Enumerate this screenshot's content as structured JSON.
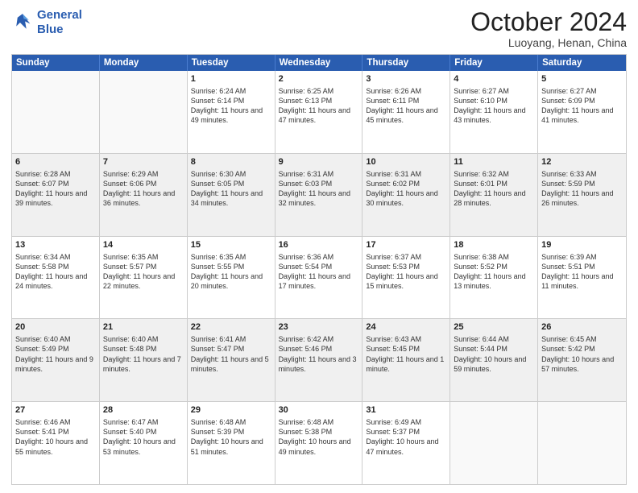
{
  "header": {
    "logo_line1": "General",
    "logo_line2": "Blue",
    "main_title": "October 2024",
    "subtitle": "Luoyang, Henan, China"
  },
  "days_of_week": [
    "Sunday",
    "Monday",
    "Tuesday",
    "Wednesday",
    "Thursday",
    "Friday",
    "Saturday"
  ],
  "weeks": [
    [
      {
        "day": "",
        "empty": true
      },
      {
        "day": "",
        "empty": true
      },
      {
        "day": "1",
        "sunrise": "Sunrise: 6:24 AM",
        "sunset": "Sunset: 6:14 PM",
        "daylight": "Daylight: 11 hours and 49 minutes."
      },
      {
        "day": "2",
        "sunrise": "Sunrise: 6:25 AM",
        "sunset": "Sunset: 6:13 PM",
        "daylight": "Daylight: 11 hours and 47 minutes."
      },
      {
        "day": "3",
        "sunrise": "Sunrise: 6:26 AM",
        "sunset": "Sunset: 6:11 PM",
        "daylight": "Daylight: 11 hours and 45 minutes."
      },
      {
        "day": "4",
        "sunrise": "Sunrise: 6:27 AM",
        "sunset": "Sunset: 6:10 PM",
        "daylight": "Daylight: 11 hours and 43 minutes."
      },
      {
        "day": "5",
        "sunrise": "Sunrise: 6:27 AM",
        "sunset": "Sunset: 6:09 PM",
        "daylight": "Daylight: 11 hours and 41 minutes."
      }
    ],
    [
      {
        "day": "6",
        "sunrise": "Sunrise: 6:28 AM",
        "sunset": "Sunset: 6:07 PM",
        "daylight": "Daylight: 11 hours and 39 minutes."
      },
      {
        "day": "7",
        "sunrise": "Sunrise: 6:29 AM",
        "sunset": "Sunset: 6:06 PM",
        "daylight": "Daylight: 11 hours and 36 minutes."
      },
      {
        "day": "8",
        "sunrise": "Sunrise: 6:30 AM",
        "sunset": "Sunset: 6:05 PM",
        "daylight": "Daylight: 11 hours and 34 minutes."
      },
      {
        "day": "9",
        "sunrise": "Sunrise: 6:31 AM",
        "sunset": "Sunset: 6:03 PM",
        "daylight": "Daylight: 11 hours and 32 minutes."
      },
      {
        "day": "10",
        "sunrise": "Sunrise: 6:31 AM",
        "sunset": "Sunset: 6:02 PM",
        "daylight": "Daylight: 11 hours and 30 minutes."
      },
      {
        "day": "11",
        "sunrise": "Sunrise: 6:32 AM",
        "sunset": "Sunset: 6:01 PM",
        "daylight": "Daylight: 11 hours and 28 minutes."
      },
      {
        "day": "12",
        "sunrise": "Sunrise: 6:33 AM",
        "sunset": "Sunset: 5:59 PM",
        "daylight": "Daylight: 11 hours and 26 minutes."
      }
    ],
    [
      {
        "day": "13",
        "sunrise": "Sunrise: 6:34 AM",
        "sunset": "Sunset: 5:58 PM",
        "daylight": "Daylight: 11 hours and 24 minutes."
      },
      {
        "day": "14",
        "sunrise": "Sunrise: 6:35 AM",
        "sunset": "Sunset: 5:57 PM",
        "daylight": "Daylight: 11 hours and 22 minutes."
      },
      {
        "day": "15",
        "sunrise": "Sunrise: 6:35 AM",
        "sunset": "Sunset: 5:55 PM",
        "daylight": "Daylight: 11 hours and 20 minutes."
      },
      {
        "day": "16",
        "sunrise": "Sunrise: 6:36 AM",
        "sunset": "Sunset: 5:54 PM",
        "daylight": "Daylight: 11 hours and 17 minutes."
      },
      {
        "day": "17",
        "sunrise": "Sunrise: 6:37 AM",
        "sunset": "Sunset: 5:53 PM",
        "daylight": "Daylight: 11 hours and 15 minutes."
      },
      {
        "day": "18",
        "sunrise": "Sunrise: 6:38 AM",
        "sunset": "Sunset: 5:52 PM",
        "daylight": "Daylight: 11 hours and 13 minutes."
      },
      {
        "day": "19",
        "sunrise": "Sunrise: 6:39 AM",
        "sunset": "Sunset: 5:51 PM",
        "daylight": "Daylight: 11 hours and 11 minutes."
      }
    ],
    [
      {
        "day": "20",
        "sunrise": "Sunrise: 6:40 AM",
        "sunset": "Sunset: 5:49 PM",
        "daylight": "Daylight: 11 hours and 9 minutes."
      },
      {
        "day": "21",
        "sunrise": "Sunrise: 6:40 AM",
        "sunset": "Sunset: 5:48 PM",
        "daylight": "Daylight: 11 hours and 7 minutes."
      },
      {
        "day": "22",
        "sunrise": "Sunrise: 6:41 AM",
        "sunset": "Sunset: 5:47 PM",
        "daylight": "Daylight: 11 hours and 5 minutes."
      },
      {
        "day": "23",
        "sunrise": "Sunrise: 6:42 AM",
        "sunset": "Sunset: 5:46 PM",
        "daylight": "Daylight: 11 hours and 3 minutes."
      },
      {
        "day": "24",
        "sunrise": "Sunrise: 6:43 AM",
        "sunset": "Sunset: 5:45 PM",
        "daylight": "Daylight: 11 hours and 1 minute."
      },
      {
        "day": "25",
        "sunrise": "Sunrise: 6:44 AM",
        "sunset": "Sunset: 5:44 PM",
        "daylight": "Daylight: 10 hours and 59 minutes."
      },
      {
        "day": "26",
        "sunrise": "Sunrise: 6:45 AM",
        "sunset": "Sunset: 5:42 PM",
        "daylight": "Daylight: 10 hours and 57 minutes."
      }
    ],
    [
      {
        "day": "27",
        "sunrise": "Sunrise: 6:46 AM",
        "sunset": "Sunset: 5:41 PM",
        "daylight": "Daylight: 10 hours and 55 minutes."
      },
      {
        "day": "28",
        "sunrise": "Sunrise: 6:47 AM",
        "sunset": "Sunset: 5:40 PM",
        "daylight": "Daylight: 10 hours and 53 minutes."
      },
      {
        "day": "29",
        "sunrise": "Sunrise: 6:48 AM",
        "sunset": "Sunset: 5:39 PM",
        "daylight": "Daylight: 10 hours and 51 minutes."
      },
      {
        "day": "30",
        "sunrise": "Sunrise: 6:48 AM",
        "sunset": "Sunset: 5:38 PM",
        "daylight": "Daylight: 10 hours and 49 minutes."
      },
      {
        "day": "31",
        "sunrise": "Sunrise: 6:49 AM",
        "sunset": "Sunset: 5:37 PM",
        "daylight": "Daylight: 10 hours and 47 minutes."
      },
      {
        "day": "",
        "empty": true
      },
      {
        "day": "",
        "empty": true
      }
    ]
  ]
}
